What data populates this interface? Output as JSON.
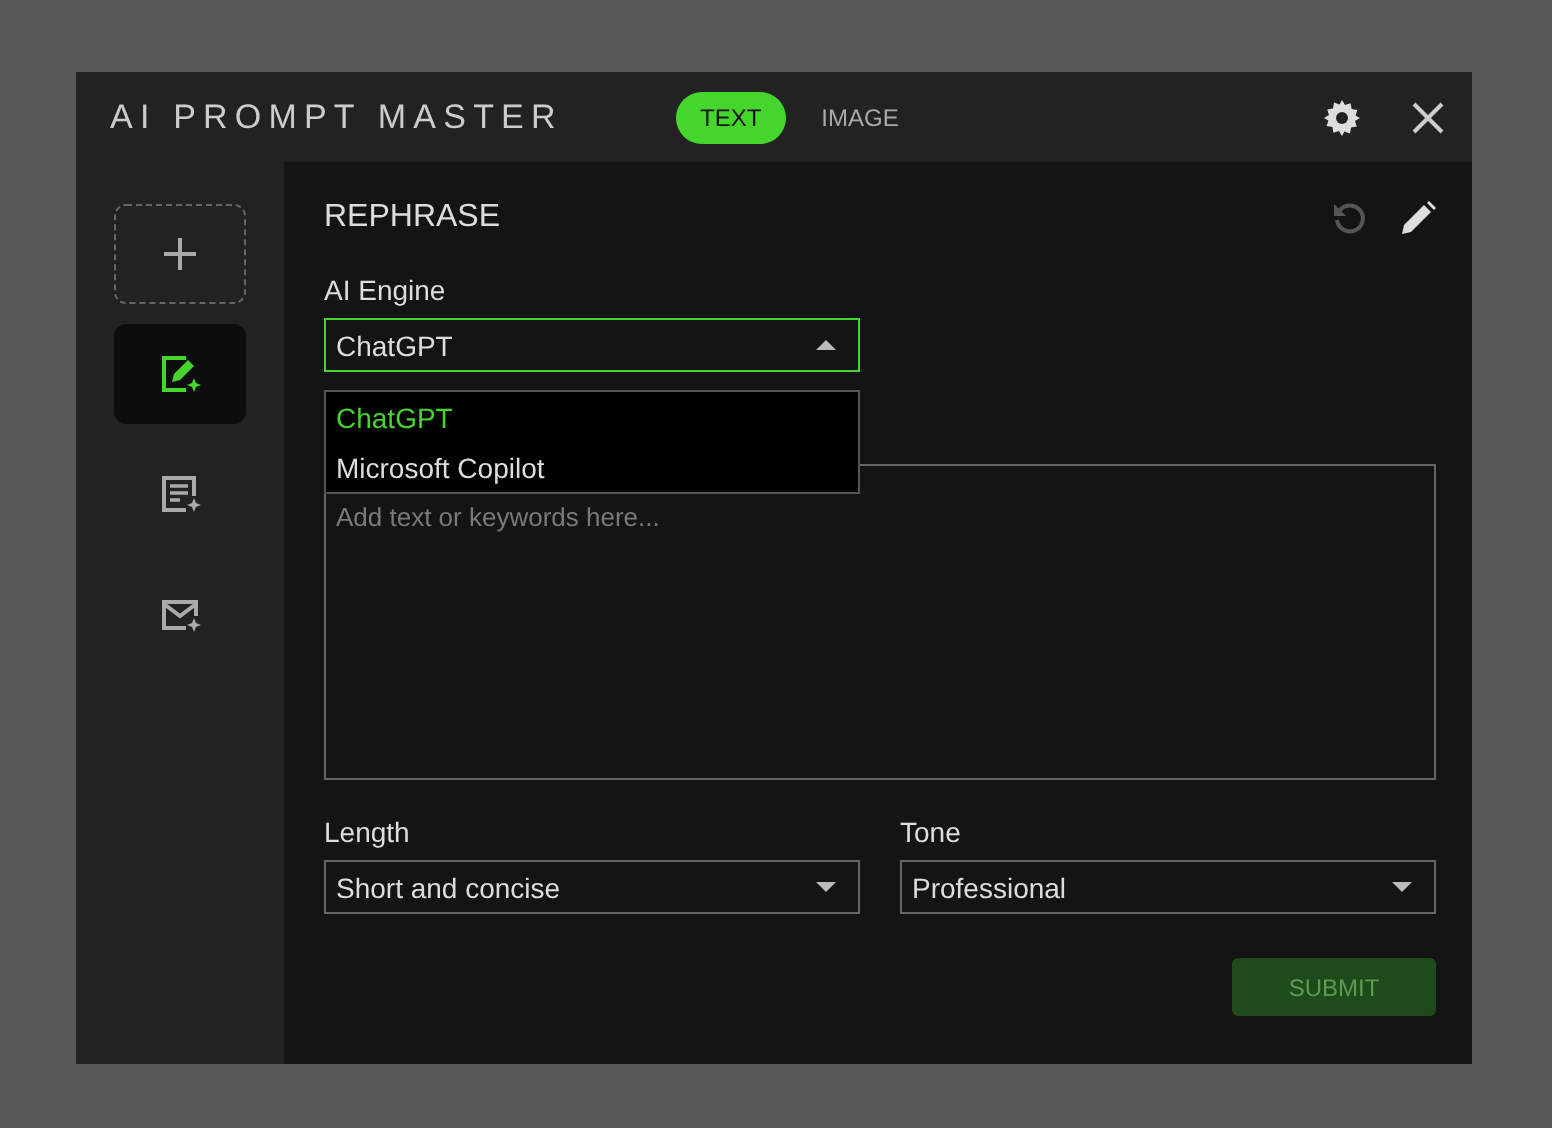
{
  "window": {
    "title": "AI PROMPT MASTER"
  },
  "tabs": [
    {
      "label": "TEXT",
      "selected": true
    },
    {
      "label": "IMAGE",
      "selected": false
    }
  ],
  "sidebar": {
    "items": [
      {
        "kind": "add",
        "selected": false
      },
      {
        "kind": "rephrase",
        "selected": true
      },
      {
        "kind": "document",
        "selected": false
      },
      {
        "kind": "mail",
        "selected": false
      }
    ]
  },
  "panel": {
    "title": "REPHRASE",
    "actions": [
      {
        "kind": "undo",
        "disabled": true
      },
      {
        "kind": "edit",
        "disabled": false
      }
    ],
    "engine": {
      "label": "AI Engine",
      "value": "ChatGPT",
      "expanded": true,
      "options": [
        {
          "label": "ChatGPT",
          "selected": true
        },
        {
          "label": "Microsoft Copilot",
          "selected": false
        }
      ]
    },
    "input": {
      "placeholder": "Add text or keywords here..."
    },
    "length": {
      "label": "Length",
      "value": "Short and concise"
    },
    "tone": {
      "label": "Tone",
      "value": "Professional"
    },
    "submit": {
      "label": "SUBMIT",
      "disabled": true
    }
  }
}
